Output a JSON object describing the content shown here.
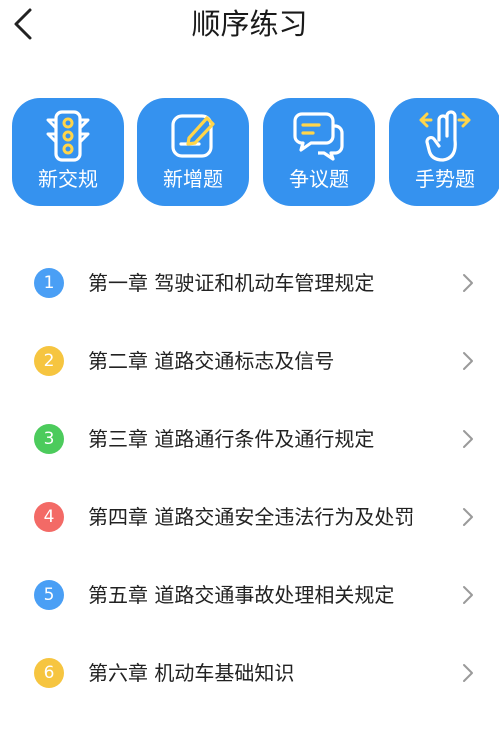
{
  "header": {
    "title": "顺序练习",
    "back_icon": "chevron-left-icon"
  },
  "categories": [
    {
      "label": "新交规",
      "icon": "traffic-light-icon"
    },
    {
      "label": "新增题",
      "icon": "edit-note-icon"
    },
    {
      "label": "争议题",
      "icon": "chat-bubbles-icon"
    },
    {
      "label": "手势题",
      "icon": "hand-gesture-icon"
    }
  ],
  "chapters": [
    {
      "num": "1",
      "label": "第一章  驾驶证和机动车管理规定",
      "color": "#4a9ff5"
    },
    {
      "num": "2",
      "label": "第二章  道路交通标志及信号",
      "color": "#f6c540"
    },
    {
      "num": "3",
      "label": "第三章  道路通行条件及通行规定",
      "color": "#4ccb5c"
    },
    {
      "num": "4",
      "label": "第四章  道路交通安全违法行为及处罚",
      "color": "#f36a66"
    },
    {
      "num": "5",
      "label": "第五章  道路交通事故处理相关规定",
      "color": "#4a9ff5"
    },
    {
      "num": "6",
      "label": "第六章  机动车基础知识",
      "color": "#f6c540"
    }
  ],
  "colors": {
    "accent": "#3592ef",
    "icon_accent": "#ffd54a"
  }
}
